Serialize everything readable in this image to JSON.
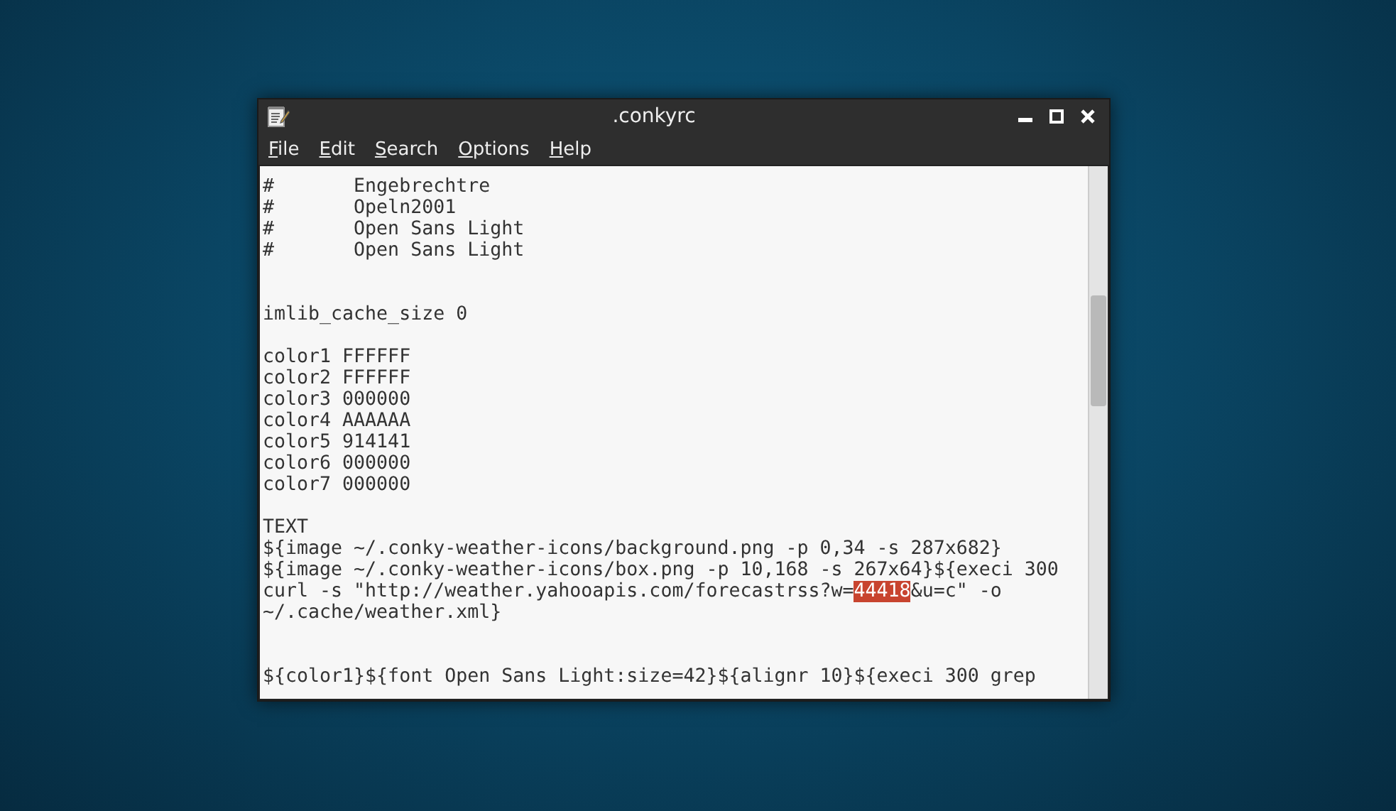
{
  "window": {
    "title": ".conkyrc"
  },
  "menu": [
    {
      "label": "File"
    },
    {
      "label": "Edit"
    },
    {
      "label": "Search"
    },
    {
      "label": "Options"
    },
    {
      "label": "Help"
    }
  ],
  "editor": {
    "lines": [
      {
        "kind": "plain",
        "text": "#       Engebrechtre"
      },
      {
        "kind": "plain",
        "text": "#       Opeln2001"
      },
      {
        "kind": "plain",
        "text": "#       Open Sans Light"
      },
      {
        "kind": "plain",
        "text": "#       Open Sans Light"
      },
      {
        "kind": "blank"
      },
      {
        "kind": "blank"
      },
      {
        "kind": "plain",
        "text": "imlib_cache_size 0"
      },
      {
        "kind": "blank"
      },
      {
        "kind": "plain",
        "text": "color1 FFFFFF"
      },
      {
        "kind": "plain",
        "text": "color2 FFFFFF"
      },
      {
        "kind": "plain",
        "text": "color3 000000"
      },
      {
        "kind": "plain",
        "text": "color4 AAAAAA"
      },
      {
        "kind": "plain",
        "text": "color5 914141"
      },
      {
        "kind": "plain",
        "text": "color6 000000"
      },
      {
        "kind": "plain",
        "text": "color7 000000"
      },
      {
        "kind": "blank"
      },
      {
        "kind": "plain",
        "text": "TEXT"
      },
      {
        "kind": "plain",
        "text": "${image ~/.conky-weather-icons/background.png -p 0,34 -s 287x682}"
      },
      {
        "kind": "plain",
        "text": "${image ~/.conky-weather-icons/box.png -p 10,168 -s 267x64}${execi 300"
      },
      {
        "kind": "parts",
        "parts": [
          {
            "text": "curl -s \"http://weather.yahooapis.com/forecastrss?w=",
            "highlighted": false
          },
          {
            "text": "44418",
            "highlighted": true
          },
          {
            "text": "&u=c\" -o",
            "highlighted": false
          }
        ]
      },
      {
        "kind": "plain",
        "text": "~/.cache/weather.xml}"
      },
      {
        "kind": "blank"
      },
      {
        "kind": "blank"
      },
      {
        "kind": "plain",
        "text": "${color1}${font Open Sans Light:size=42}${alignr 10}${execi 300 grep"
      }
    ]
  }
}
